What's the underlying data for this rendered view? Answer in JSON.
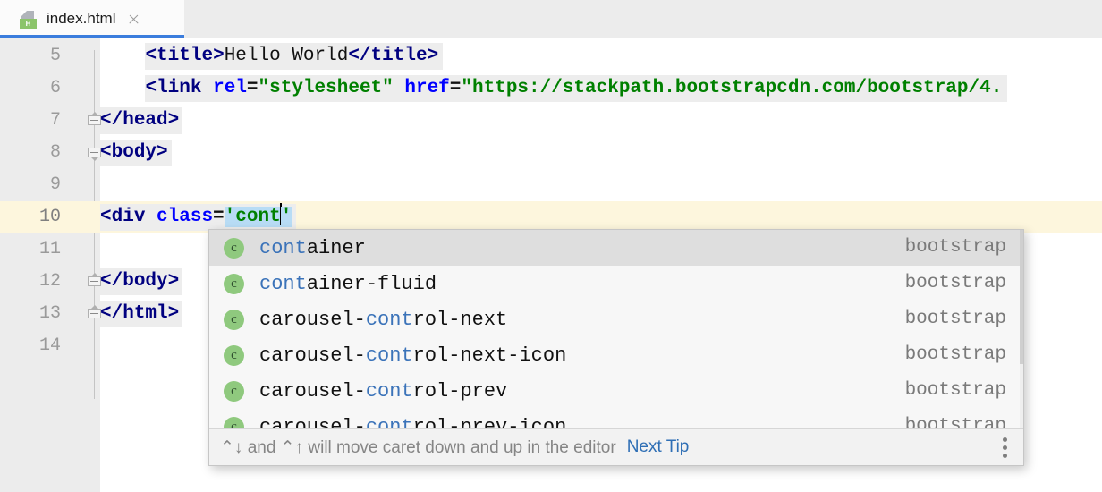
{
  "tab": {
    "filename": "index.html",
    "icon_name": "html-file-icon",
    "icon_badge": "H",
    "close_label": "×"
  },
  "editor": {
    "lines": [
      {
        "number": "5",
        "indent": 4,
        "fold": "none",
        "current": false,
        "tokens": [
          {
            "t": "<",
            "c": "tg"
          },
          {
            "t": "title",
            "c": "tg"
          },
          {
            "t": ">",
            "c": "tg"
          },
          {
            "t": "Hello World",
            "c": "txt"
          },
          {
            "t": "</",
            "c": "tg"
          },
          {
            "t": "title",
            "c": "tg"
          },
          {
            "t": ">",
            "c": "tg"
          }
        ]
      },
      {
        "number": "6",
        "indent": 4,
        "fold": "none",
        "current": false,
        "tokens": [
          {
            "t": "<",
            "c": "tg"
          },
          {
            "t": "link",
            "c": "tg"
          },
          {
            "t": " ",
            "c": "txt"
          },
          {
            "t": "rel",
            "c": "attr"
          },
          {
            "t": "=",
            "c": "eq"
          },
          {
            "t": "\"stylesheet\"",
            "c": "val"
          },
          {
            "t": " ",
            "c": "txt"
          },
          {
            "t": "href",
            "c": "attr"
          },
          {
            "t": "=",
            "c": "eq"
          },
          {
            "t": "\"https://stackpath.bootstrapcdn.com/bootstrap/4.",
            "c": "val"
          }
        ]
      },
      {
        "number": "7",
        "indent": 0,
        "fold": "end",
        "current": false,
        "tokens": [
          {
            "t": "</",
            "c": "tg"
          },
          {
            "t": "head",
            "c": "tg"
          },
          {
            "t": ">",
            "c": "tg"
          }
        ]
      },
      {
        "number": "8",
        "indent": 0,
        "fold": "start",
        "current": false,
        "tokens": [
          {
            "t": "<",
            "c": "tg"
          },
          {
            "t": "body",
            "c": "tg"
          },
          {
            "t": ">",
            "c": "tg"
          }
        ]
      },
      {
        "number": "9",
        "indent": 0,
        "fold": "none",
        "current": false,
        "tokens": []
      },
      {
        "number": "10",
        "indent": 0,
        "fold": "none",
        "current": true,
        "tokens": [
          {
            "t": "<",
            "c": "tg"
          },
          {
            "t": "div",
            "c": "tg"
          },
          {
            "t": " ",
            "c": "txt"
          },
          {
            "t": "class",
            "c": "attr"
          },
          {
            "t": "=",
            "c": "eq"
          },
          {
            "t": "'",
            "c": "val selval"
          },
          {
            "t": "cont",
            "c": "val selval"
          },
          {
            "t": "CARET",
            "c": "caret"
          },
          {
            "t": "'",
            "c": "val selval"
          }
        ]
      },
      {
        "number": "11",
        "indent": 0,
        "fold": "none",
        "current": false,
        "tokens": []
      },
      {
        "number": "12",
        "indent": 0,
        "fold": "end",
        "current": false,
        "tokens": [
          {
            "t": "</",
            "c": "tg"
          },
          {
            "t": "body",
            "c": "tg"
          },
          {
            "t": ">",
            "c": "tg"
          }
        ]
      },
      {
        "number": "13",
        "indent": 0,
        "fold": "end",
        "current": false,
        "tokens": [
          {
            "t": "</",
            "c": "tg"
          },
          {
            "t": "html",
            "c": "tg"
          },
          {
            "t": ">",
            "c": "tg"
          }
        ]
      },
      {
        "number": "14",
        "indent": 0,
        "fold": "none",
        "current": false,
        "tokens": []
      }
    ]
  },
  "completion": {
    "prefix": "cont",
    "items": [
      {
        "label": "container",
        "type": "bootstrap",
        "selected": true,
        "icon": "c"
      },
      {
        "label": "container-fluid",
        "type": "bootstrap",
        "selected": false,
        "icon": "c"
      },
      {
        "label": "carousel-control-next",
        "type": "bootstrap",
        "selected": false,
        "icon": "c"
      },
      {
        "label": "carousel-control-next-icon",
        "type": "bootstrap",
        "selected": false,
        "icon": "c"
      },
      {
        "label": "carousel-control-prev",
        "type": "bootstrap",
        "selected": false,
        "icon": "c"
      },
      {
        "label": "carousel-control-prev-icon",
        "type": "bootstrap",
        "selected": false,
        "icon": "c"
      }
    ],
    "tip": {
      "text": "⌃↓ and ⌃↑ will move caret down and up in the editor",
      "link": "Next Tip",
      "menu_icon": "kebab-menu-icon"
    }
  },
  "colors": {
    "accent": "#3b7ddd",
    "tag": "#000080",
    "attribute": "#0000ff",
    "value": "#008000",
    "match_highlight": "#3b73b9",
    "current_line": "#fdf6dd",
    "selection": "#b8dcf5",
    "icon_green": "#8fc97e",
    "link": "#2f6fb5"
  }
}
